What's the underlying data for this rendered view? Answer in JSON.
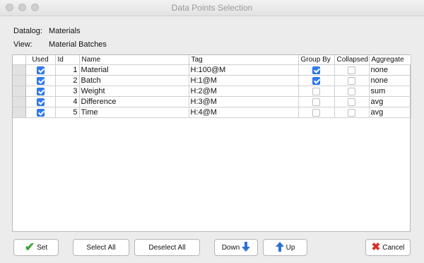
{
  "window": {
    "title": "Data Points Selection"
  },
  "info": {
    "datalog_label": "Datalog:",
    "datalog_value": "Materials",
    "view_label": "View:",
    "view_value": "Material Batches"
  },
  "table": {
    "columns": [
      "Used",
      "Id",
      "Name",
      "Tag",
      "Group By",
      "Collapsed",
      "Aggregate"
    ],
    "rows": [
      {
        "used": true,
        "id": "1",
        "name": "Material",
        "tag": "H:100@M",
        "group_by": true,
        "collapsed": false,
        "aggregate": "none"
      },
      {
        "used": true,
        "id": "2",
        "name": "Batch",
        "tag": "H:1@M",
        "group_by": true,
        "collapsed": false,
        "aggregate": "none"
      },
      {
        "used": true,
        "id": "3",
        "name": "Weight",
        "tag": "H:2@M",
        "group_by": false,
        "collapsed": false,
        "aggregate": "sum"
      },
      {
        "used": true,
        "id": "4",
        "name": "Difference",
        "tag": "H:3@M",
        "group_by": false,
        "collapsed": false,
        "aggregate": "avg"
      },
      {
        "used": true,
        "id": "5",
        "name": "Time",
        "tag": "H:4@M",
        "group_by": false,
        "collapsed": false,
        "aggregate": "avg"
      }
    ]
  },
  "buttons": {
    "set": "Set",
    "select_all": "Select All",
    "deselect_all": "Deselect All",
    "down": "Down",
    "up": "Up",
    "cancel": "Cancel"
  },
  "icons": {
    "set": "checkmark-icon",
    "down": "arrow-down-icon",
    "up": "arrow-up-icon",
    "cancel": "x-icon"
  },
  "colors": {
    "check_accent": "#2f7df6",
    "set_icon": "#3aa63a",
    "cancel_icon": "#d9302a",
    "arrow_icon": "#2f6fd6"
  }
}
